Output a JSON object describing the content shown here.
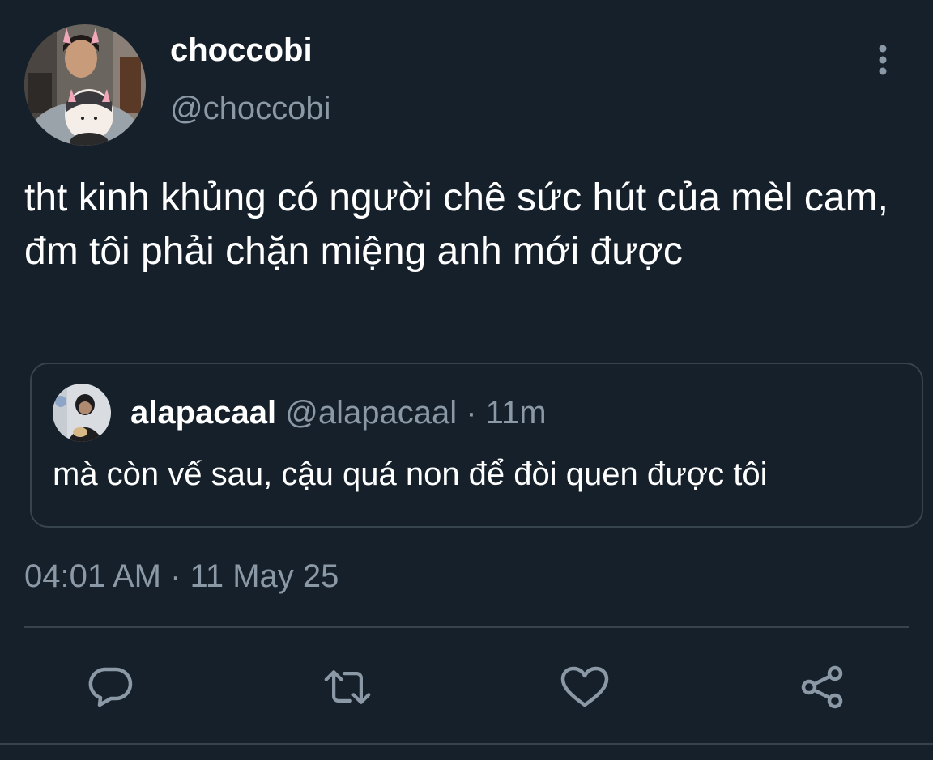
{
  "tweet": {
    "display_name": "choccobi",
    "handle": "@choccobi",
    "text": "tht kinh khủng có người chê sức hút của mèl cam, đm tôi phải chặn miệng anh mới được",
    "timestamp": "04:01 AM · 11 May 25"
  },
  "quote": {
    "display_name": "alapacaal",
    "meta": "@alapacaal · 11m",
    "text": "mà còn vế sau, cậu quá non để đòi quen được tôi"
  },
  "actions": [
    "reply-icon",
    "retweet-icon",
    "like-icon",
    "share-icon"
  ],
  "colors": {
    "background": "#15202b",
    "text_primary": "#ffffff",
    "text_secondary": "#8b98a5",
    "border": "#38444d"
  }
}
